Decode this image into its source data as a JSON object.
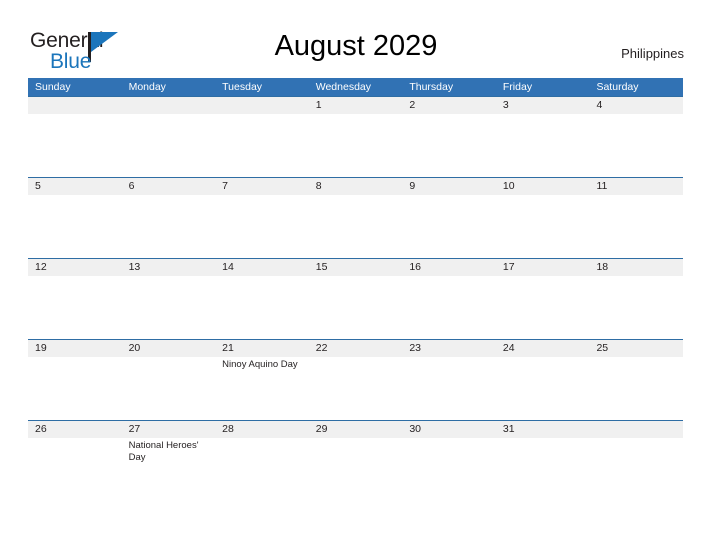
{
  "branding": {
    "name_part1": "General",
    "name_part2": "Blue",
    "accent_color": "#1b75bb"
  },
  "header": {
    "title": "August 2029",
    "region": "Philippines"
  },
  "theme": {
    "header_blue": "#3172b4",
    "row_border_blue": "#2e6da4",
    "band_gray": "#f0f0f0",
    "text_color": "#231f20"
  },
  "calendar": {
    "weekdays": [
      "Sunday",
      "Monday",
      "Tuesday",
      "Wednesday",
      "Thursday",
      "Friday",
      "Saturday"
    ],
    "weeks": [
      [
        {
          "day": ""
        },
        {
          "day": ""
        },
        {
          "day": ""
        },
        {
          "day": "1"
        },
        {
          "day": "2"
        },
        {
          "day": "3"
        },
        {
          "day": "4"
        }
      ],
      [
        {
          "day": "5"
        },
        {
          "day": "6"
        },
        {
          "day": "7"
        },
        {
          "day": "8"
        },
        {
          "day": "9"
        },
        {
          "day": "10"
        },
        {
          "day": "11"
        }
      ],
      [
        {
          "day": "12"
        },
        {
          "day": "13"
        },
        {
          "day": "14"
        },
        {
          "day": "15"
        },
        {
          "day": "16"
        },
        {
          "day": "17"
        },
        {
          "day": "18"
        }
      ],
      [
        {
          "day": "19"
        },
        {
          "day": "20"
        },
        {
          "day": "21",
          "event": "Ninoy Aquino Day"
        },
        {
          "day": "22"
        },
        {
          "day": "23"
        },
        {
          "day": "24"
        },
        {
          "day": "25"
        }
      ],
      [
        {
          "day": "26"
        },
        {
          "day": "27",
          "event": "National Heroes' Day"
        },
        {
          "day": "28"
        },
        {
          "day": "29"
        },
        {
          "day": "30"
        },
        {
          "day": "31"
        },
        {
          "day": ""
        }
      ]
    ]
  }
}
